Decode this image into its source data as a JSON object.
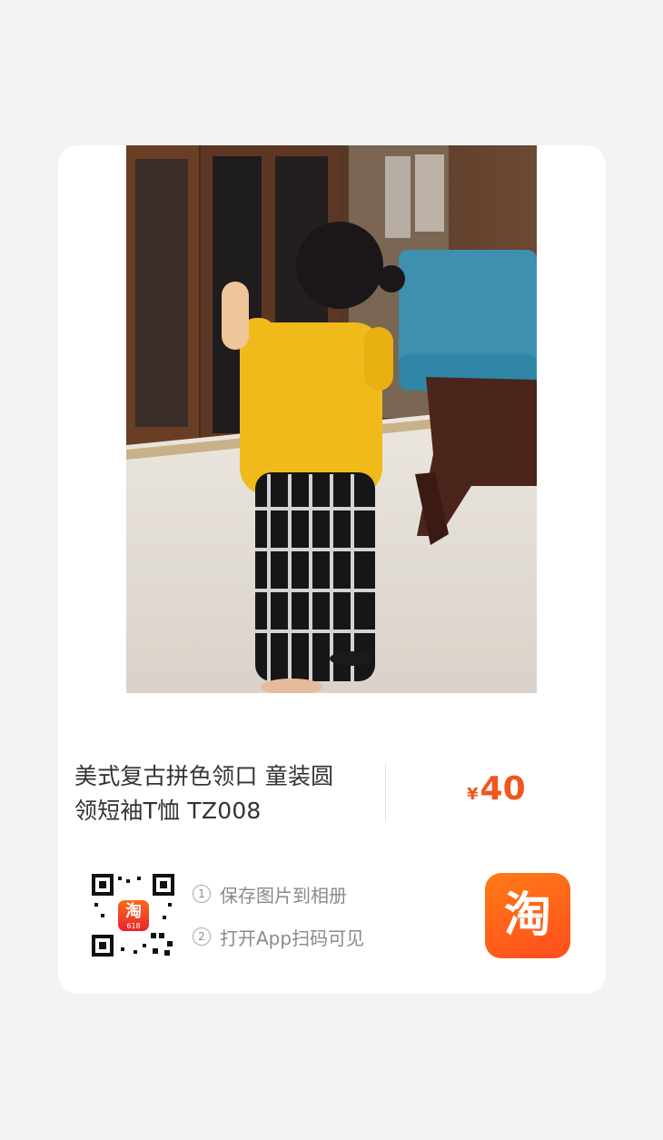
{
  "product": {
    "title_line1": "美式复古拼色领口 童装圆",
    "title_line2": "领短袖T恤 TZ008",
    "currency_symbol": "¥",
    "price": "40",
    "image": "child-in-yellow-tshirt-photo"
  },
  "share": {
    "qr_logo_text": "淘",
    "qr_logo_badge": "618",
    "steps": [
      {
        "number": "1",
        "text": "保存图片到相册"
      },
      {
        "number": "2",
        "text": "打开App扫码可见"
      }
    ],
    "app_logo_text": "淘"
  },
  "colors": {
    "background": "#f3f3f3",
    "card": "#ffffff",
    "price": "#f0561e",
    "taobao_orange": "#ff6a1a"
  }
}
